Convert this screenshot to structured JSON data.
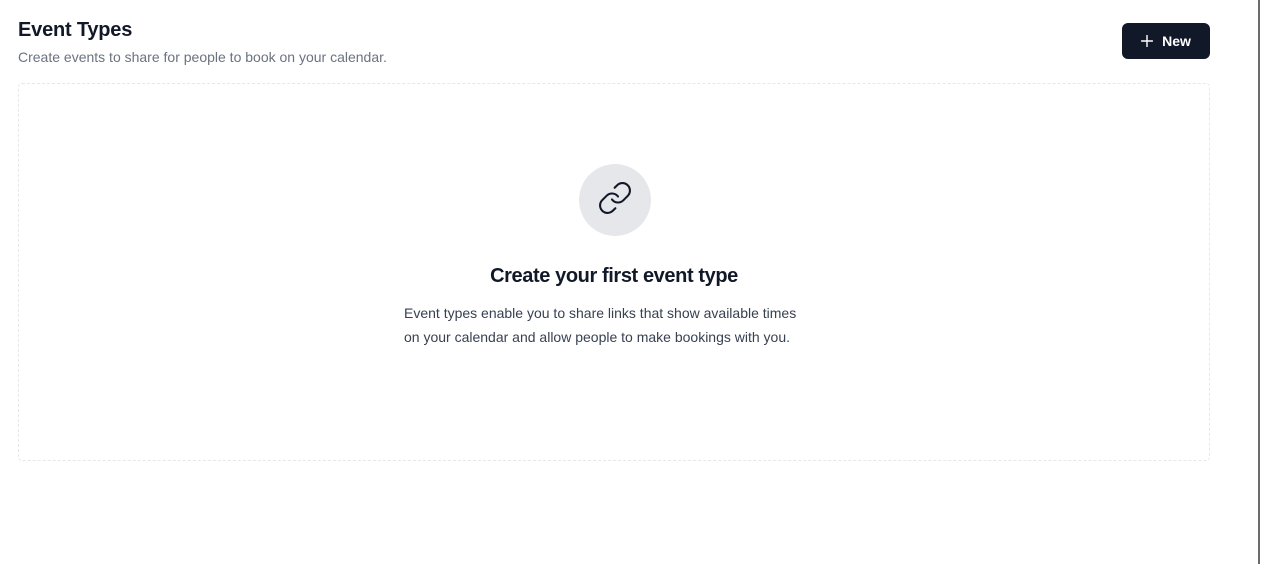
{
  "header": {
    "title": "Event Types",
    "subtitle": "Create events to share for people to book on your calendar.",
    "new_button_label": "New",
    "new_button_icon": "plus-icon"
  },
  "empty_state": {
    "icon": "link-icon",
    "title": "Create your first event type",
    "description_line1": "Event types enable you to share links that show available times",
    "description_line2": "on your calendar and allow people to make bookings with you."
  },
  "colors": {
    "primary_button_bg": "#111827",
    "primary_button_text": "#ffffff",
    "icon_circle_bg": "#e5e7eb",
    "subtitle_text": "#6b7280",
    "border_dashed": "#e5e7eb"
  }
}
